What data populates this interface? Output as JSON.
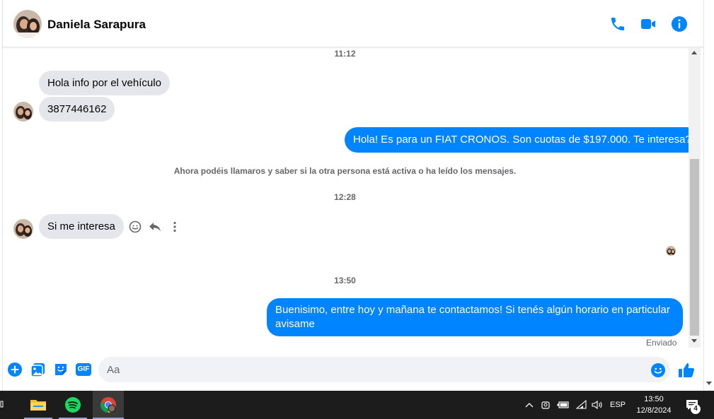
{
  "header": {
    "contact_name": "Daniela Sarapura",
    "icons": [
      "phone-icon",
      "video-call-icon",
      "info-icon"
    ]
  },
  "conversation": {
    "timestamps": [
      "11:12",
      "12:28",
      "13:50"
    ],
    "notice": "Ahora podéis llamaros y saber si la otra persona está activa o ha leído los mensajes.",
    "incoming": [
      {
        "text": "Hola info por el vehículo"
      },
      {
        "text": "3877446162"
      },
      {
        "text": "Si me interesa"
      }
    ],
    "outgoing": [
      {
        "text": "Hola! Es para un FIAT CRONOS. Son cuotas de $197.000. Te interesa?"
      },
      {
        "text": "Buenisimo, entre hoy y mañana te contactamos! Si tenés algún horario en particular avisame"
      }
    ],
    "message_status": "Enviado"
  },
  "composer": {
    "placeholder": "Aa",
    "gif_label": "GIF"
  },
  "taskbar": {
    "language": "ESP",
    "time": "13:50",
    "date": "12/8/2024",
    "notification_count": "4"
  },
  "colors": {
    "accent": "#0084ff",
    "incoming_bubble": "#e4e6eb",
    "taskbar": "#1c1c1c"
  }
}
